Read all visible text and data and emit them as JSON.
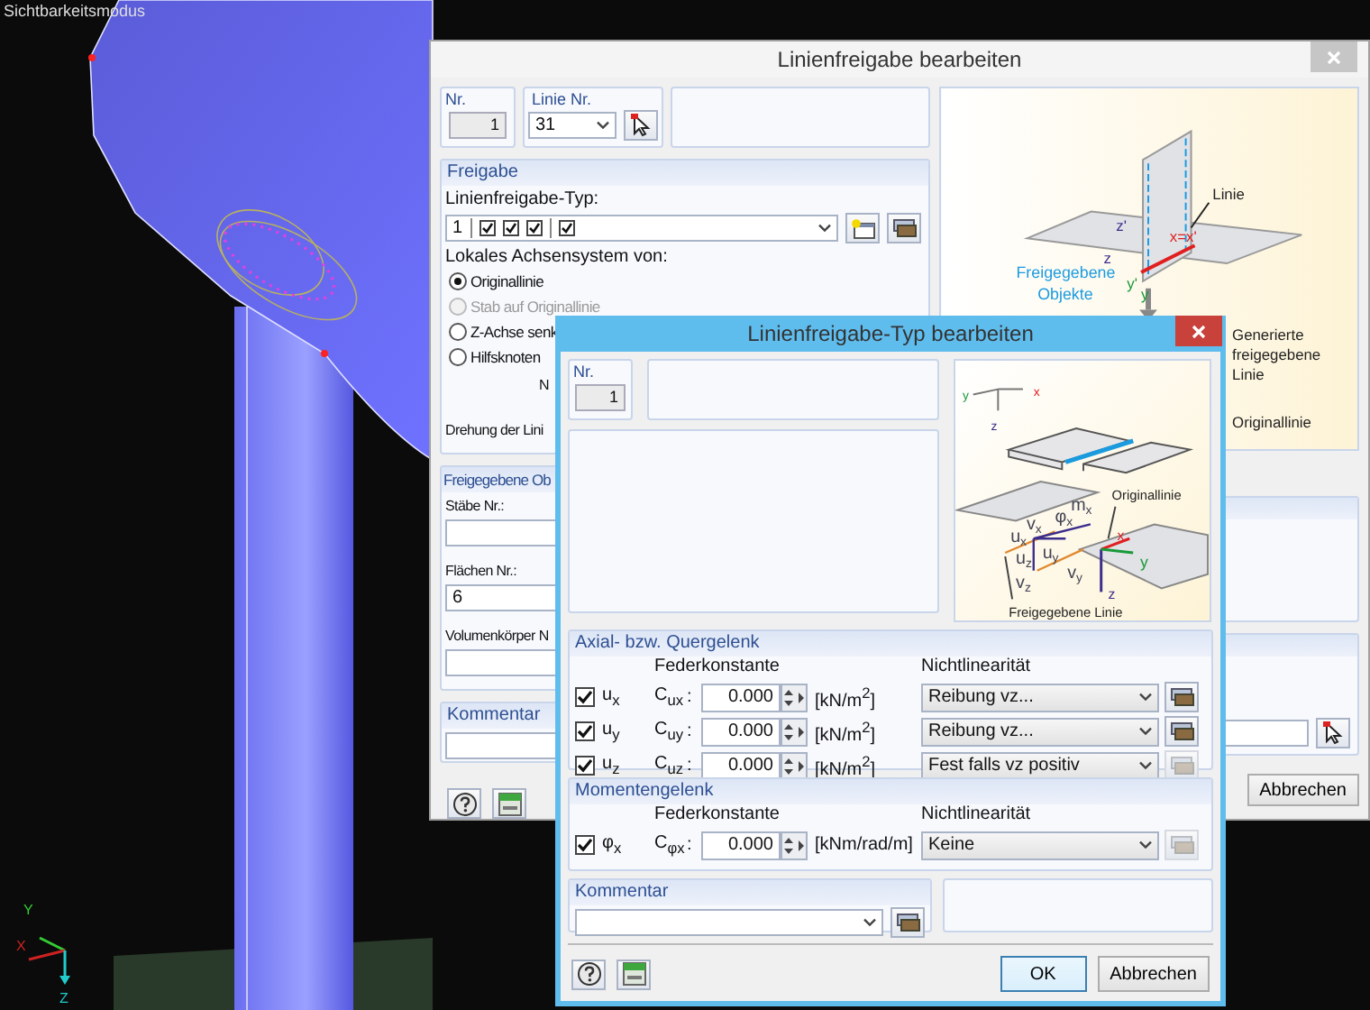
{
  "viewport": {
    "mode_label": "Sichtbarkeitsmodus",
    "axes": [
      "Y",
      "X",
      "Z"
    ]
  },
  "back_window": {
    "title": "Linienfreigabe bearbeiten",
    "nr": {
      "label": "Nr.",
      "value": "1"
    },
    "line_nr": {
      "label": "Linie Nr.",
      "value": "31"
    },
    "release": {
      "header": "Freigabe",
      "type_label": "Linienfreigabe-Typ:",
      "type_number": "1",
      "type_checks": [
        [
          true,
          true,
          true
        ],
        [
          true
        ]
      ],
      "axis_label": "Lokales Achsensystem von:",
      "axis_options": [
        {
          "label": "Originallinie",
          "selected": true,
          "disabled": false
        },
        {
          "label": "Stab auf Originallinie",
          "selected": false,
          "disabled": true
        },
        {
          "label": "Z-Achse senk",
          "selected": false,
          "disabled": false
        },
        {
          "label": "Hilfsknoten",
          "selected": false,
          "disabled": false
        }
      ],
      "node_label": "N",
      "rotation_label": "Drehung der Lini"
    },
    "released_objects": {
      "header": "Freigegebene Ob",
      "members_label": "Stäbe Nr.:",
      "surfaces_label": "Flächen Nr.:",
      "surfaces_value": "6",
      "solids_label": "Volumenkörper N"
    },
    "comment": {
      "header": "Kommentar"
    },
    "diagram": {
      "labels": [
        "Linie",
        "z'",
        "x=x'",
        "z",
        "y'",
        "y",
        "Freigegebene",
        "Objekte",
        "Generierte",
        "freigegebene",
        "Linie",
        "Originallinie"
      ]
    },
    "buttons": {
      "cancel": "Abbrechen"
    }
  },
  "front_window": {
    "title": "Linienfreigabe-Typ bearbeiten",
    "nr": {
      "label": "Nr.",
      "value": "1"
    },
    "diagram": {
      "axis_labels": [
        "y",
        "x",
        "z"
      ],
      "labels": [
        {
          "text": "Originallinie"
        },
        {
          "text": "m",
          "sub": "x"
        },
        {
          "text": "φ",
          "sub": "x"
        },
        {
          "text": "v",
          "sub": "x"
        },
        {
          "text": "u",
          "sub": "x"
        },
        {
          "text": "x"
        },
        {
          "text": "u",
          "sub": "y"
        },
        {
          "text": "u",
          "sub": "z"
        },
        {
          "text": "y"
        },
        {
          "text": "v",
          "sub": "y"
        },
        {
          "text": "v",
          "sub": "z"
        },
        {
          "text": "z"
        },
        {
          "text": "Freigegebene Linie"
        }
      ]
    },
    "axial": {
      "header": "Axial- bzw. Quergelenk",
      "spring_header": "Federkonstante",
      "nonlinear_header": "Nichtlinearität",
      "rows": [
        {
          "checked": true,
          "dof": "u$_{x}$",
          "constant": "C$_{ux}$",
          "sep": ":",
          "value": "0.000",
          "unit": "[kN/m$^{2}$]",
          "nonlinearity": "Reibung vz...",
          "details_enabled": true
        },
        {
          "checked": true,
          "dof": "u$_{y}$",
          "constant": "C$_{uy}$",
          "sep": ":",
          "value": "0.000",
          "unit": "[kN/m$^{2}$]",
          "nonlinearity": "Reibung vz...",
          "details_enabled": true
        },
        {
          "checked": true,
          "dof": "u$_{z}$",
          "constant": "C$_{uz}$",
          "sep": ":",
          "value": "0.000",
          "unit": "[kN/m$^{2}$]",
          "nonlinearity": "Fest falls vz positiv",
          "details_enabled": false
        }
      ]
    },
    "moment": {
      "header": "Momentengelenk",
      "spring_header": "Federkonstante",
      "nonlinear_header": "Nichtlinearität",
      "rows": [
        {
          "checked": true,
          "dof": "φ$_{x}$",
          "constant": "C$_{φx}$",
          "sep": ":",
          "value": "0.000",
          "unit": "[kNm/rad/m]",
          "nonlinearity": "Keine",
          "details_enabled": false
        }
      ]
    },
    "comment": {
      "header": "Kommentar"
    },
    "buttons": {
      "ok": "OK",
      "cancel": "Abbrechen"
    }
  }
}
